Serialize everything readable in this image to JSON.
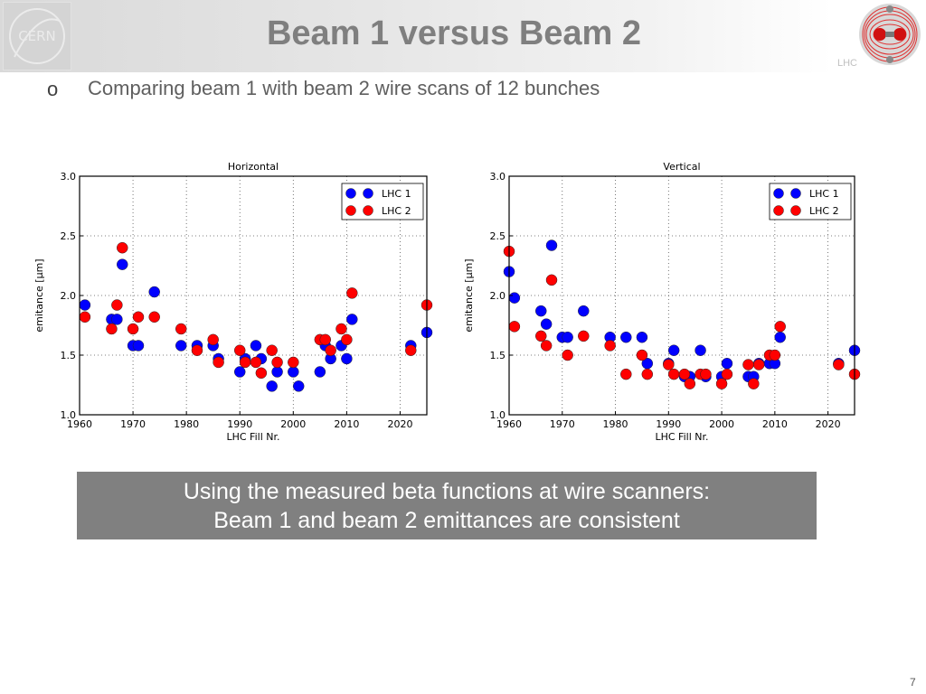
{
  "slide": {
    "title": "Beam 1 versus Beam 2",
    "bullet_marker": "o",
    "subtitle": "Comparing beam 1 with beam 2 wire scans of 12 bunches",
    "callout_line1": "Using the measured beta functions at wire scanners:",
    "callout_line2": "Beam 1 and beam 2 emittances are consistent",
    "page_number": "7",
    "logos": {
      "left": "CERN",
      "right": "LHC"
    }
  },
  "colors": {
    "lhc1": "#0000ff",
    "lhc2": "#ff0000",
    "callout_bg": "#808080",
    "title": "#7f7f7f"
  },
  "chart_data": [
    {
      "type": "scatter",
      "title": "Horizontal",
      "xlabel": "LHC Fill Nr.",
      "ylabel": "emitance [μm]",
      "xlim": [
        1960,
        2025
      ],
      "ylim": [
        1.0,
        3.0
      ],
      "xticks": [
        1960,
        1970,
        1980,
        1990,
        2000,
        2010,
        2020
      ],
      "yticks": [
        1.0,
        1.5,
        2.0,
        2.5,
        3.0
      ],
      "ytick_labels": [
        "1.0",
        "1.5",
        "2.0",
        "2.5",
        "3.0"
      ],
      "grid": true,
      "legend": "top-right",
      "series": [
        {
          "name": "LHC 1",
          "color": "#0000ff",
          "x": [
            1961,
            1966,
            1967,
            1968,
            1970,
            1971,
            1974,
            1979,
            1982,
            1985,
            1986,
            1990,
            1991,
            1993,
            1994,
            1996,
            1997,
            2000,
            2001,
            2005,
            2006,
            2007,
            2009,
            2010,
            2011,
            2022,
            2025
          ],
          "y": [
            1.92,
            1.8,
            1.8,
            2.26,
            1.58,
            1.58,
            2.03,
            1.58,
            1.58,
            1.58,
            1.47,
            1.36,
            1.47,
            1.58,
            1.47,
            1.24,
            1.36,
            1.36,
            1.24,
            1.36,
            1.58,
            1.47,
            1.58,
            1.47,
            1.8,
            1.58,
            1.69
          ]
        },
        {
          "name": "LHC 2",
          "color": "#ff0000",
          "x": [
            1961,
            1966,
            1967,
            1968,
            1970,
            1971,
            1974,
            1979,
            1982,
            1985,
            1986,
            1990,
            1991,
            1993,
            1994,
            1996,
            1997,
            2000,
            2005,
            2006,
            2007,
            2009,
            2010,
            2011,
            2022,
            2025
          ],
          "y": [
            1.82,
            1.72,
            1.92,
            2.4,
            1.72,
            1.82,
            1.82,
            1.72,
            1.54,
            1.63,
            1.44,
            1.54,
            1.44,
            1.44,
            1.35,
            1.54,
            1.44,
            1.44,
            1.63,
            1.63,
            1.54,
            1.72,
            1.63,
            2.02,
            1.54,
            1.92
          ]
        }
      ]
    },
    {
      "type": "scatter",
      "title": "Vertical",
      "xlabel": "LHC Fill Nr.",
      "ylabel": "emitance [μm]",
      "xlim": [
        1960,
        2025
      ],
      "ylim": [
        1.0,
        3.0
      ],
      "xticks": [
        1960,
        1970,
        1980,
        1990,
        2000,
        2010,
        2020
      ],
      "yticks": [
        1.0,
        1.5,
        2.0,
        2.5,
        3.0
      ],
      "ytick_labels": [
        "1.0",
        "1.5",
        "2.0",
        "2.5",
        "3.0"
      ],
      "grid": true,
      "legend": "top-right",
      "series": [
        {
          "name": "LHC 1",
          "color": "#0000ff",
          "x": [
            1960,
            1961,
            1966,
            1967,
            1968,
            1970,
            1971,
            1974,
            1979,
            1982,
            1985,
            1986,
            1990,
            1991,
            1993,
            1994,
            1996,
            1997,
            2000,
            2001,
            2005,
            2006,
            2007,
            2009,
            2010,
            2011,
            2022,
            2025
          ],
          "y": [
            2.2,
            1.98,
            1.87,
            1.76,
            2.42,
            1.65,
            1.65,
            1.87,
            1.65,
            1.65,
            1.65,
            1.43,
            1.43,
            1.54,
            1.32,
            1.32,
            1.54,
            1.32,
            1.32,
            1.43,
            1.32,
            1.32,
            1.43,
            1.43,
            1.43,
            1.65,
            1.43,
            1.54
          ]
        },
        {
          "name": "LHC 2",
          "color": "#ff0000",
          "x": [
            1960,
            1961,
            1966,
            1967,
            1968,
            1971,
            1974,
            1979,
            1982,
            1985,
            1986,
            1990,
            1991,
            1993,
            1994,
            1996,
            1997,
            2000,
            2001,
            2005,
            2006,
            2007,
            2009,
            2010,
            2011,
            2022,
            2025
          ],
          "y": [
            2.37,
            1.74,
            1.66,
            1.58,
            2.13,
            1.5,
            1.66,
            1.58,
            1.34,
            1.5,
            1.34,
            1.42,
            1.34,
            1.34,
            1.26,
            1.34,
            1.34,
            1.26,
            1.34,
            1.42,
            1.26,
            1.42,
            1.5,
            1.5,
            1.74,
            1.42,
            1.34
          ]
        }
      ]
    }
  ]
}
